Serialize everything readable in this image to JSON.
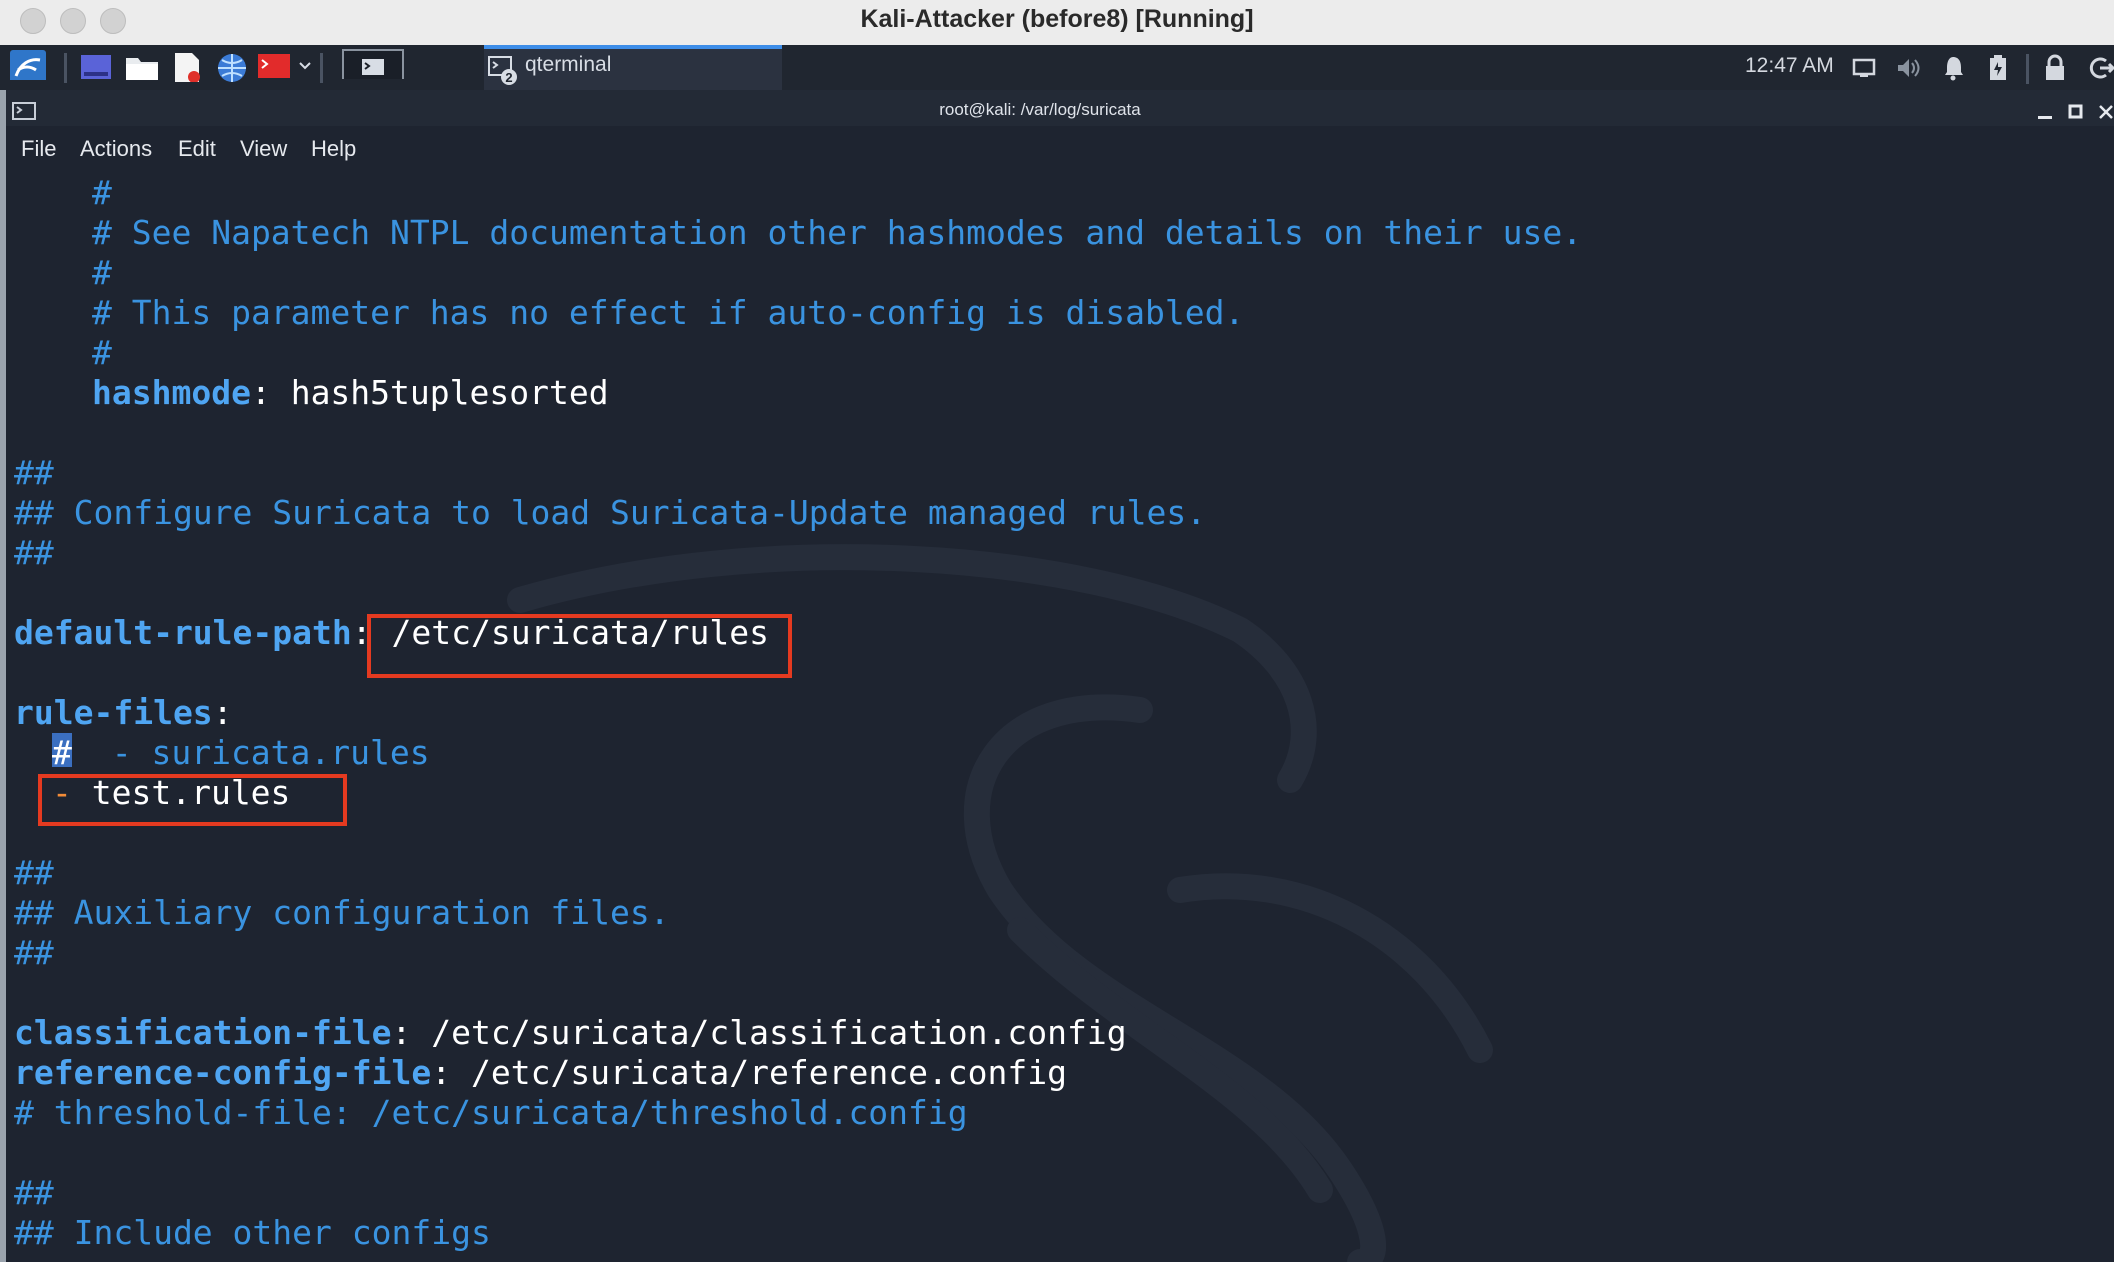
{
  "vm_window": {
    "title": "Kali-Attacker (before8) [Running]"
  },
  "panel": {
    "task_label": "qterminal",
    "task_badge": "2",
    "clock": "12:47 AM",
    "icons": [
      "kali-menu-icon",
      "workspace-icon",
      "file-manager-icon",
      "text-editor-icon",
      "browser-icon",
      "terminal-launcher-icon",
      "chevron-down-icon",
      "terminal-icon",
      "display-icon",
      "volume-icon",
      "notification-icon",
      "battery-icon",
      "lock-icon",
      "logout-icon"
    ]
  },
  "terminal": {
    "title": "root@kali: /var/log/suricata",
    "menu": [
      "File",
      "Actions",
      "Edit",
      "View",
      "Help"
    ]
  },
  "editor": {
    "l1": "#",
    "l2": "# See Napatech NTPL documentation other hashmodes and details on their use.",
    "l3": "#",
    "l4": "# This parameter has no effect if auto-config is disabled.",
    "l5": "#",
    "hashmode_key": "hashmode",
    "hashmode_val": " hash5tuplesorted",
    "hash1": "##",
    "configure": "## Configure Suricata to load Suricata-Update managed rules.",
    "hash2": "##",
    "drp_key": "default-rule-path",
    "drp_val": " /etc/suricata/rules",
    "rf_key": "rule-files",
    "cursor_char": "#",
    "suricata_rules": "  - suricata.rules",
    "dash": "-",
    "test_rules": " test.rules",
    "hash3": "##",
    "aux": "## Auxiliary configuration files.",
    "hash4": "##",
    "class_key": "classification-file",
    "class_val": " /etc/suricata/classification.config",
    "ref_key": "reference-config-file",
    "ref_val": " /etc/suricata/reference.config",
    "threshold": "# threshold-file: /etc/suricata/threshold.config",
    "hash5": "##",
    "include": "## Include other configs",
    "colon": ":"
  },
  "colors": {
    "comment": "#3a93e0",
    "key": "#4fa5f2",
    "highlight_box": "#e53a20",
    "background": "#1e2430"
  }
}
